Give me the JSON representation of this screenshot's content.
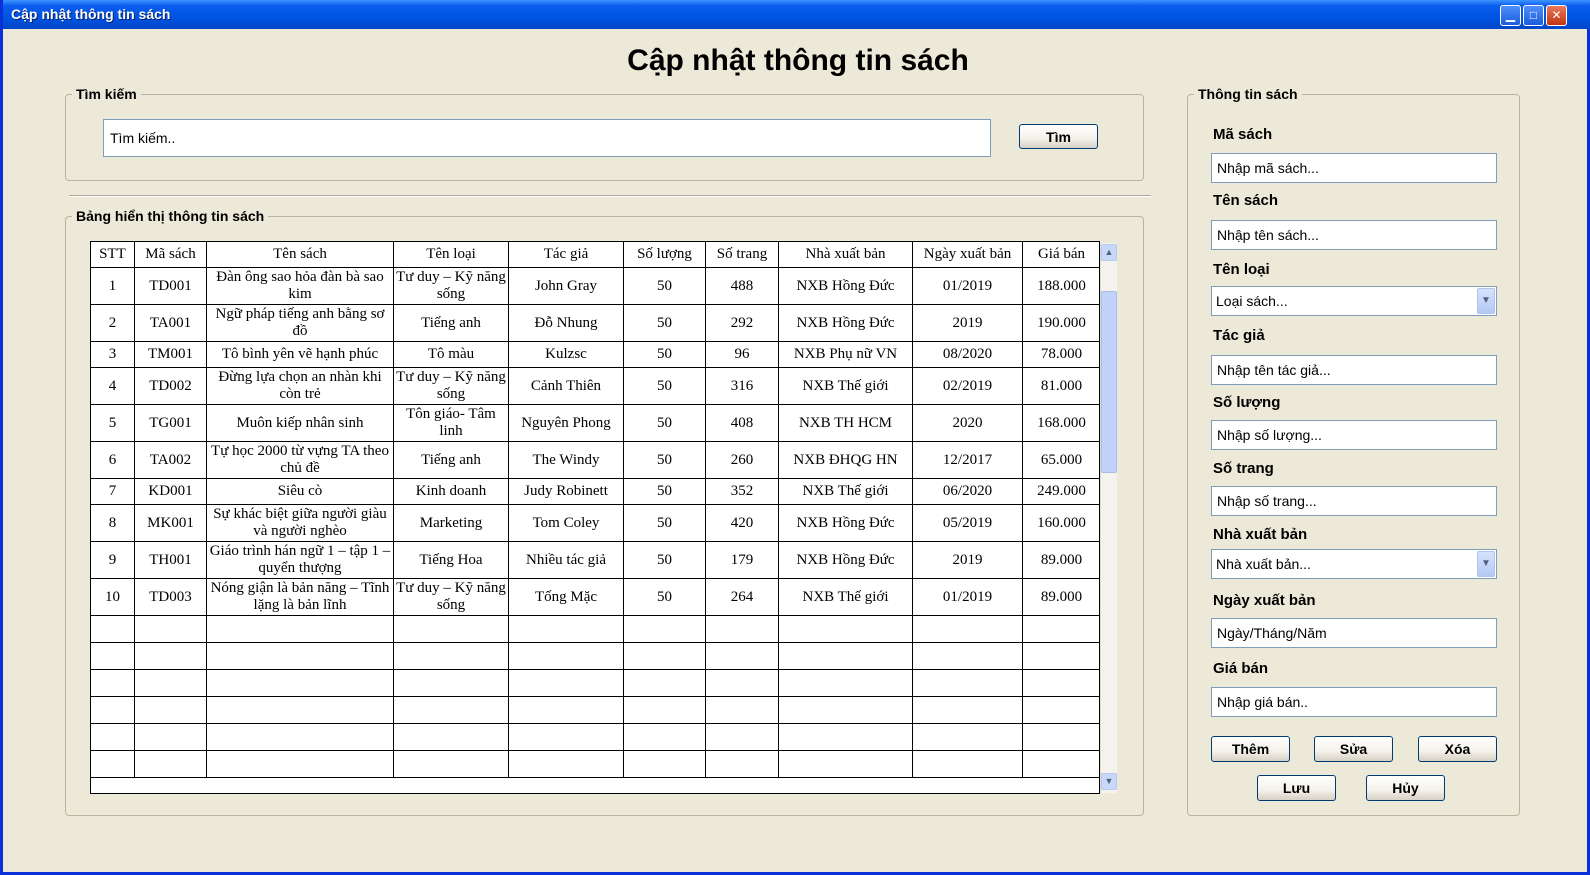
{
  "window": {
    "title": "Cập nhật thông tin sách"
  },
  "titlebar_icons": {
    "minimize": "minimize-icon",
    "maximize": "maximize-icon",
    "close": "close-icon"
  },
  "heading": "Cập nhật thông tin sách",
  "search": {
    "legend": "Tìm kiếm",
    "value": "Tìm kiếm..",
    "button": "Tìm"
  },
  "table": {
    "legend": "Bảng hiển thị thông tin sách",
    "columns": [
      "STT",
      "Mã sách",
      "Tên sách",
      "Tên loại",
      "Tác giả",
      "Số lượng",
      "Số trang",
      "Nhà xuất bản",
      "Ngày xuất bản",
      "Giá bán"
    ],
    "rows": [
      [
        "1",
        "TD001",
        "Đàn ông sao hỏa đàn bà sao kim",
        "Tư duy – Kỹ năng sống",
        "John Gray",
        "50",
        "488",
        "NXB Hồng Đức",
        "01/2019",
        "188.000"
      ],
      [
        "2",
        "TA001",
        "Ngữ pháp tiếng anh bằng sơ đồ",
        "Tiếng anh",
        "Đỗ Nhung",
        "50",
        "292",
        "NXB Hồng Đức",
        "2019",
        "190.000"
      ],
      [
        "3",
        "TM001",
        "Tô bình yên vẽ hạnh phúc",
        "Tô màu",
        "Kulzsc",
        "50",
        "96",
        "NXB Phụ nữ VN",
        "08/2020",
        "78.000"
      ],
      [
        "4",
        "TD002",
        "Đừng lựa chọn an nhàn khi còn trẻ",
        "Tư duy – Kỹ năng sống",
        "Cảnh Thiên",
        "50",
        "316",
        "NXB Thế giới",
        "02/2019",
        "81.000"
      ],
      [
        "5",
        "TG001",
        "Muôn kiếp nhân sinh",
        "Tôn giáo- Tâm linh",
        "Nguyên Phong",
        "50",
        "408",
        "NXB TH HCM",
        "2020",
        "168.000"
      ],
      [
        "6",
        "TA002",
        "Tự học 2000 từ vựng TA theo chủ đề",
        "Tiếng anh",
        "The Windy",
        "50",
        "260",
        "NXB ĐHQG HN",
        "12/2017",
        "65.000"
      ],
      [
        "7",
        "KD001",
        "Siêu cò",
        "Kinh doanh",
        "Judy Robinett",
        "50",
        "352",
        "NXB Thế giới",
        "06/2020",
        "249.000"
      ],
      [
        "8",
        "MK001",
        "Sự khác biệt giữa người giàu và người nghèo",
        "Marketing",
        "Tom Coley",
        "50",
        "420",
        "NXB Hồng Đức",
        "05/2019",
        "160.000"
      ],
      [
        "9",
        "TH001",
        "Giáo trình hán ngữ 1 – tập 1 – quyển thượng",
        "Tiếng Hoa",
        "Nhiều tác giả",
        "50",
        "179",
        "NXB Hồng Đức",
        "2019",
        "89.000"
      ],
      [
        "10",
        "TD003",
        "Nóng giận là bản năng – Tĩnh lặng là bản lĩnh",
        "Tư duy – Kỹ năng sống",
        "Tống Mặc",
        "50",
        "264",
        "NXB Thế giới",
        "01/2019",
        "89.000"
      ]
    ],
    "empty_rows": 6
  },
  "form": {
    "legend": "Thông tin sách",
    "ma_sach": {
      "label": "Mã sách",
      "value": "Nhập mã sách..."
    },
    "ten_sach": {
      "label": "Tên sách",
      "value": "Nhập tên sách..."
    },
    "ten_loai": {
      "label": "Tên loại",
      "value": "Loại sách..."
    },
    "tac_gia": {
      "label": "Tác giả",
      "value": "Nhập tên tác giả..."
    },
    "so_luong": {
      "label": "Số lượng",
      "value": "Nhập số lượng..."
    },
    "so_trang": {
      "label": "Số trang",
      "value": "Nhập số trang..."
    },
    "nha_xuat_ban": {
      "label": "Nhà xuất bản",
      "value": "Nhà xuất bản..."
    },
    "ngay_xuat_ban": {
      "label": "Ngày xuất bản",
      "value": "Ngày/Tháng/Năm"
    },
    "gia_ban": {
      "label": "Giá bán",
      "value": "Nhập giá bán.."
    }
  },
  "buttons": {
    "them": "Thêm",
    "sua": "Sửa",
    "xoa": "Xóa",
    "luu": "Lưu",
    "huy": "Hủy"
  }
}
